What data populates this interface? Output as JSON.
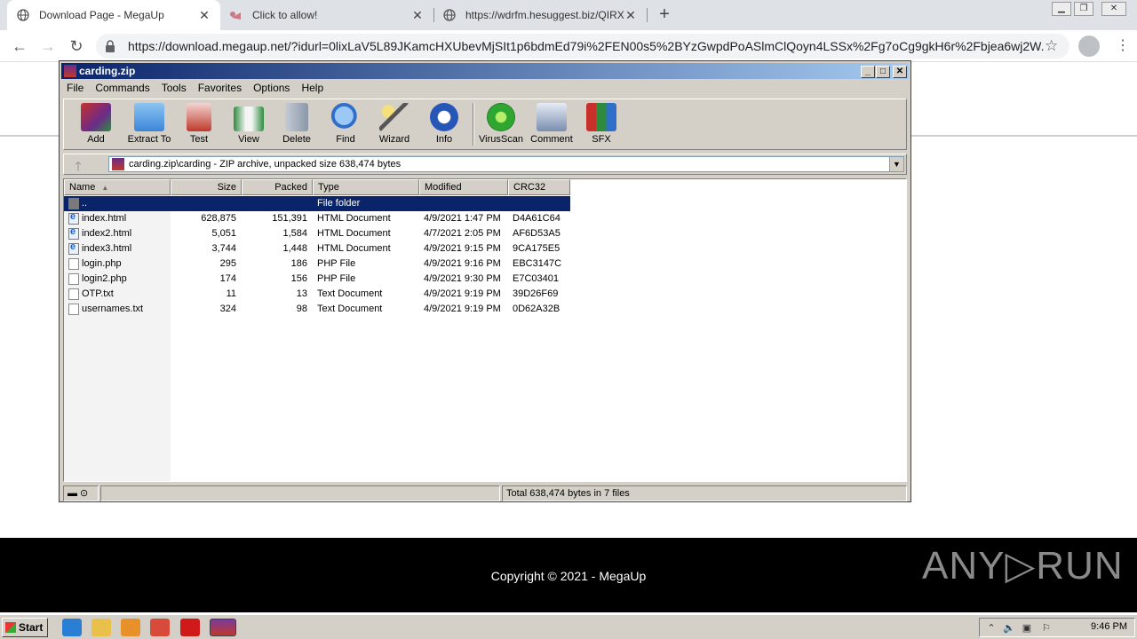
{
  "browser": {
    "tabs": [
      {
        "title": "Download Page - MegaUp",
        "favicon": "globe-icon",
        "active": true
      },
      {
        "title": "Click to allow!",
        "favicon": "bell-icon",
        "active": false
      },
      {
        "title": "https://wdrfm.hesuggest.biz/QIRXT",
        "favicon": "globe-icon",
        "active": false
      }
    ],
    "new_tab_label": "+",
    "url": "https://download.megaup.net/?idurl=0lixLaV5L89JKamcHXUbevMjSIt1p6bdmEd79i%2FEN00s5%2BYzGwpdPoASlmClQoyn4LSSx%2Fg7oCg9gkH6r%2Fbjea6wj2W..."
  },
  "page": {
    "copyright": "Copyright © 2021 - MegaUp",
    "watermark": "ANY▷RUN"
  },
  "winrar": {
    "title": "carding.zip",
    "menu": [
      "File",
      "Commands",
      "Tools",
      "Favorites",
      "Options",
      "Help"
    ],
    "toolbar": [
      {
        "label": "Add",
        "icon": "add-archive-icon",
        "color": "#c8302a"
      },
      {
        "label": "Extract To",
        "icon": "extract-folder-icon",
        "color": "#3b86d8"
      },
      {
        "label": "Test",
        "icon": "test-clipboard-icon",
        "color": "#c0392b"
      },
      {
        "label": "View",
        "icon": "view-book-icon",
        "color": "#2e8b3e"
      },
      {
        "label": "Delete",
        "icon": "delete-trash-icon",
        "color": "#8a96a8"
      },
      {
        "label": "Find",
        "icon": "find-magnifier-icon",
        "color": "#2f6fc9"
      },
      {
        "label": "Wizard",
        "icon": "wizard-wand-icon",
        "color": "#d4b12a"
      },
      {
        "label": "Info",
        "icon": "info-icon",
        "color": "#2657b8"
      },
      {
        "label": "VirusScan",
        "icon": "virusscan-bug-icon",
        "color": "#2fa62f"
      },
      {
        "label": "Comment",
        "icon": "comment-icon",
        "color": "#7a8eb0"
      },
      {
        "label": "SFX",
        "icon": "sfx-books-icon",
        "color": "#b04a9a"
      }
    ],
    "address": "carding.zip\\carding - ZIP archive, unpacked size 638,474 bytes",
    "columns": [
      "Name",
      "Size",
      "Packed",
      "Type",
      "Modified",
      "CRC32"
    ],
    "files": [
      {
        "name": "..",
        "size": "",
        "packed": "",
        "type": "File folder",
        "modified": "",
        "crc": "",
        "kind": "folder"
      },
      {
        "name": "index.html",
        "size": "628,875",
        "packed": "151,391",
        "type": "HTML Document",
        "modified": "4/9/2021 1:47 PM",
        "crc": "D4A61C64",
        "kind": "html"
      },
      {
        "name": "index2.html",
        "size": "5,051",
        "packed": "1,584",
        "type": "HTML Document",
        "modified": "4/7/2021 2:05 PM",
        "crc": "AF6D53A5",
        "kind": "html"
      },
      {
        "name": "index3.html",
        "size": "3,744",
        "packed": "1,448",
        "type": "HTML Document",
        "modified": "4/9/2021 9:15 PM",
        "crc": "9CA175E5",
        "kind": "html"
      },
      {
        "name": "login.php",
        "size": "295",
        "packed": "186",
        "type": "PHP File",
        "modified": "4/9/2021 9:16 PM",
        "crc": "EBC3147C",
        "kind": "doc"
      },
      {
        "name": "login2.php",
        "size": "174",
        "packed": "156",
        "type": "PHP File",
        "modified": "4/9/2021 9:30 PM",
        "crc": "E7C03401",
        "kind": "doc"
      },
      {
        "name": "OTP.txt",
        "size": "11",
        "packed": "13",
        "type": "Text Document",
        "modified": "4/9/2021 9:19 PM",
        "crc": "39D26F69",
        "kind": "doc"
      },
      {
        "name": "usernames.txt",
        "size": "324",
        "packed": "98",
        "type": "Text Document",
        "modified": "4/9/2021 9:19 PM",
        "crc": "0D62A32B",
        "kind": "doc"
      }
    ],
    "status": "Total 638,474 bytes in 7 files"
  },
  "taskbar": {
    "start_label": "Start",
    "apps": [
      {
        "icon": "internet-explorer-icon",
        "color": "#2a7fd4"
      },
      {
        "icon": "file-explorer-icon",
        "color": "#e8c04a"
      },
      {
        "icon": "media-player-icon",
        "color": "#e8902a"
      },
      {
        "icon": "chrome-icon",
        "color": "#d84a3a"
      },
      {
        "icon": "opera-icon",
        "color": "#d01a1a"
      },
      {
        "icon": "winrar-icon",
        "color": "#7a3a9a"
      }
    ],
    "clock": "9:46 PM"
  }
}
